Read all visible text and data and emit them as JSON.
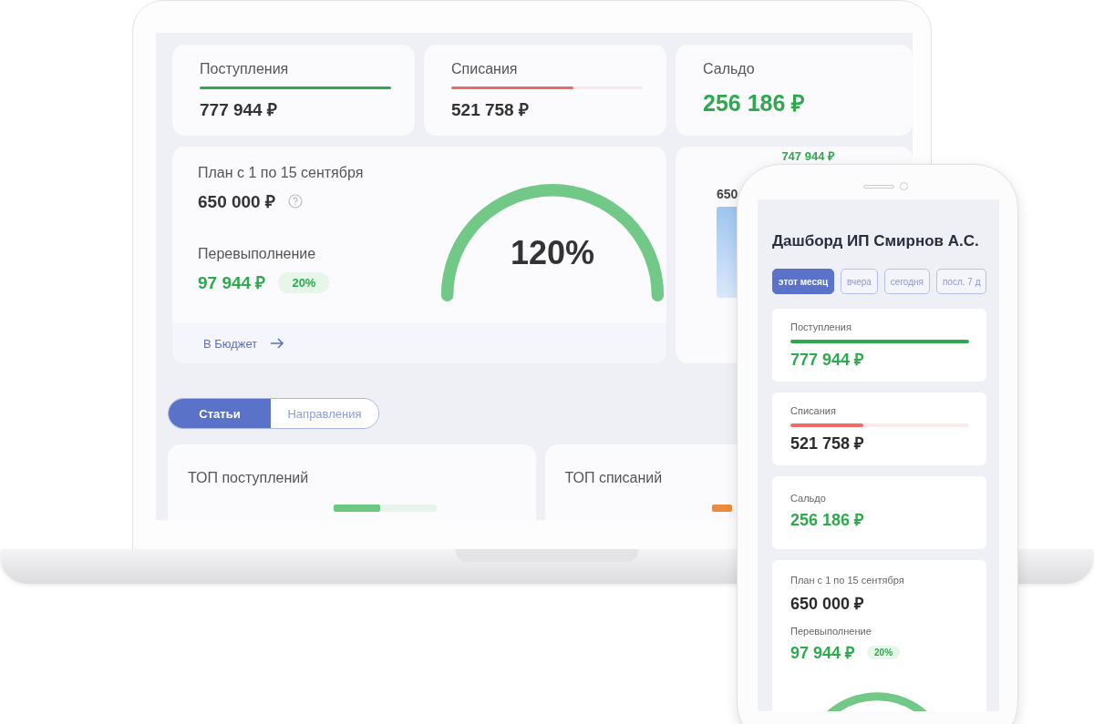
{
  "laptop": {
    "summary": [
      {
        "label": "Поступления",
        "value": "777 944 ₽",
        "kind": "bar",
        "level": 1,
        "color": "#2fa84f"
      },
      {
        "label": "Списания",
        "value": "521 758 ₽",
        "kind": "bar",
        "level": 0.64,
        "color": "#f06a6a"
      },
      {
        "label": "Сальдо",
        "value": "256 186 ₽",
        "kind": "big"
      }
    ],
    "plan": {
      "title": "План с 1 по 15 сентября",
      "amount": "650 000 ₽",
      "over_label": "Перевыполнение",
      "over_amount": "97 944 ₽",
      "over_badge": "20%",
      "gauge_value": "120%",
      "link": "В Бюджет"
    },
    "chart_card": {
      "top_value": "747 944 ₽",
      "side_value": "650"
    },
    "tabs": [
      {
        "label": "Статьи",
        "selected": true
      },
      {
        "label": "Направления",
        "selected": false
      }
    ],
    "top_cards": [
      {
        "title": "ТОП поступлений",
        "color": "#6cc77f",
        "level": 0.45
      },
      {
        "title": "ТОП списаний",
        "color": "#f08a3c",
        "level": 1
      }
    ]
  },
  "phone": {
    "title": "Дашборд ИП Смирнов А.С.",
    "periods": [
      {
        "label": "этот месяц",
        "selected": true
      },
      {
        "label": "вчера",
        "selected": false
      },
      {
        "label": "сегодня",
        "selected": false
      },
      {
        "label": "посл. 7 д",
        "selected": false
      }
    ],
    "cards": [
      {
        "label": "Поступления",
        "value": "777 944 ₽",
        "kind": "bar",
        "level": 1,
        "color": "#2fa84f",
        "positive": true
      },
      {
        "label": "Списания",
        "value": "521 758 ₽",
        "kind": "bar",
        "level": 0.41,
        "color": "#f06a6a",
        "positive": false
      },
      {
        "label": "Сальдо",
        "value": "256 186 ₽",
        "kind": "plain",
        "positive": true
      }
    ],
    "plan": {
      "title": "План с 1 по 15 сентября",
      "amount": "650 000 ₽",
      "over_label": "Перевыполнение",
      "over_amount": "97 944 ₽",
      "over_badge": "20%"
    }
  }
}
